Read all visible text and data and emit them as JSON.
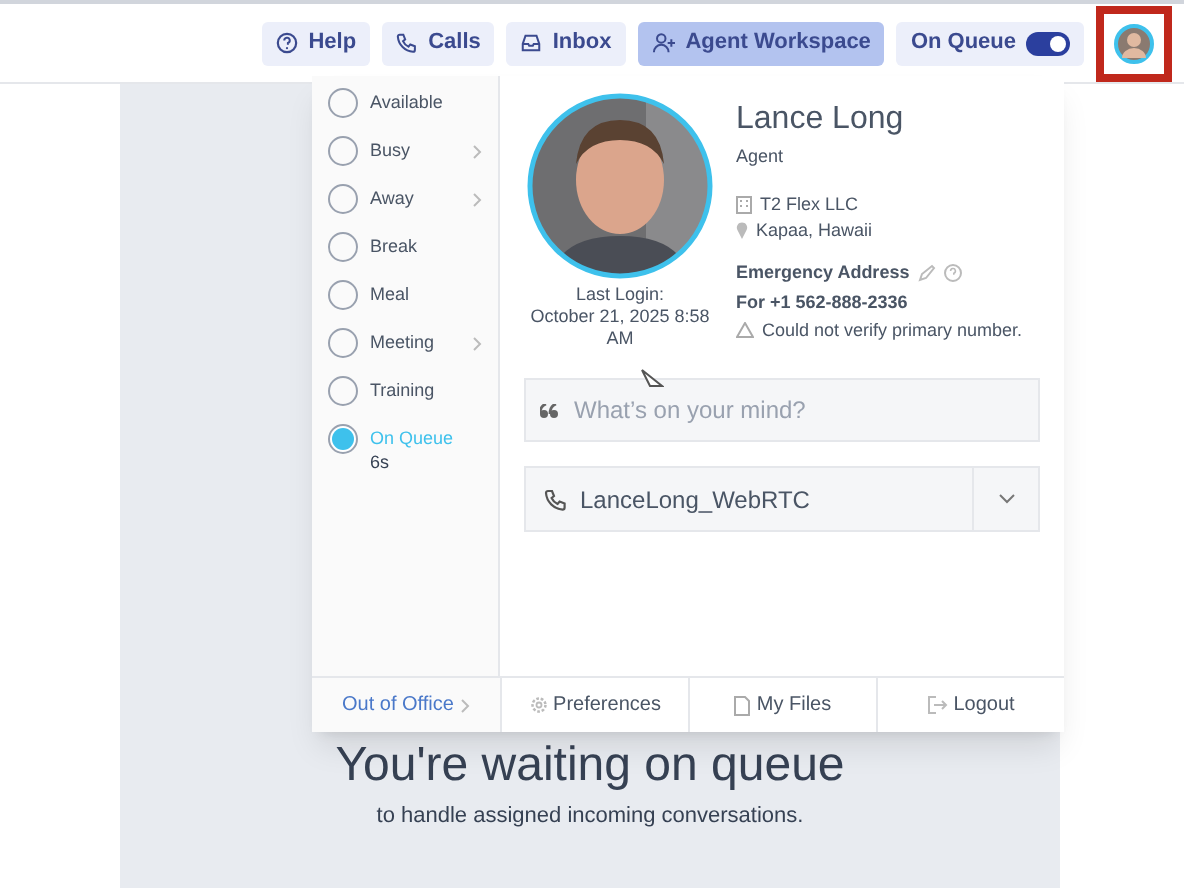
{
  "header": {
    "buttons": [
      {
        "label": "Help",
        "kind": "help",
        "selected": false
      },
      {
        "label": "Calls",
        "kind": "calls",
        "selected": false
      },
      {
        "label": "Inbox",
        "kind": "inbox",
        "selected": false
      },
      {
        "label": "Agent Workspace",
        "kind": "workspace",
        "selected": true
      }
    ],
    "queue_toggle": {
      "label": "On Queue",
      "on": true
    },
    "avatar": {
      "highlighted": true
    }
  },
  "main": {
    "heading": "You're waiting on queue",
    "subtext": "to handle assigned incoming conversations."
  },
  "status_menu": {
    "items": [
      {
        "label": "Available",
        "selected": false,
        "submenu": false
      },
      {
        "label": "Busy",
        "selected": false,
        "submenu": true
      },
      {
        "label": "Away",
        "selected": false,
        "submenu": true
      },
      {
        "label": "Break",
        "selected": false,
        "submenu": false
      },
      {
        "label": "Meal",
        "selected": false,
        "submenu": false
      },
      {
        "label": "Meeting",
        "selected": false,
        "submenu": true
      },
      {
        "label": "Training",
        "selected": false,
        "submenu": false
      },
      {
        "label": "On Queue",
        "selected": true,
        "submenu": false,
        "duration": "6s"
      }
    ]
  },
  "profile": {
    "last_login_label": "Last Login:",
    "last_login": "October 21, 2025 8:58 AM",
    "name": "Lance Long",
    "title": "Agent",
    "company": "T2 Flex LLC",
    "location": "Kapaa, Hawaii",
    "emergency_label": "Emergency Address",
    "emergency_number": "For +1 562-888-2336",
    "warning": "Could not verify primary number.",
    "status_placeholder": "What’s on your mind?",
    "phone": "LanceLong_WebRTC"
  },
  "footer": [
    {
      "label": "Out of Office",
      "kind": "out_of_office"
    },
    {
      "label": "Preferences",
      "kind": "preferences"
    },
    {
      "label": "My Files",
      "kind": "files"
    },
    {
      "label": "Logout",
      "kind": "logout"
    }
  ]
}
